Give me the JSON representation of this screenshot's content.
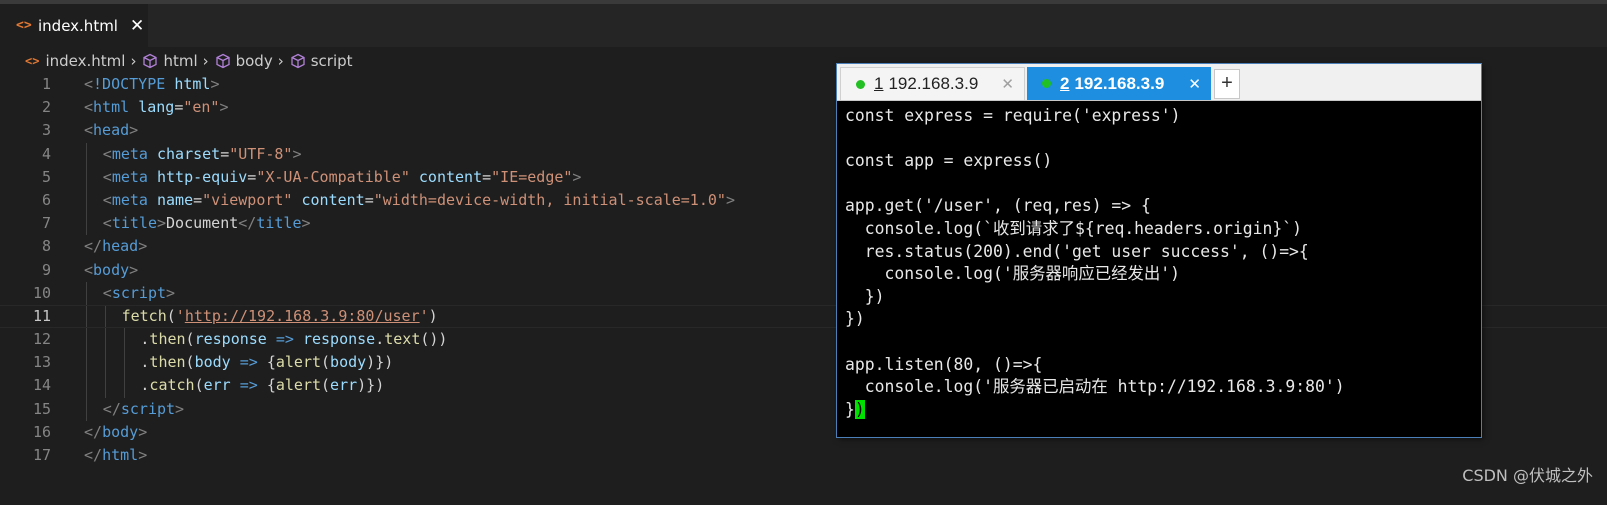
{
  "editor": {
    "tab": {
      "icon": "html-file-icon",
      "label": "index.html",
      "close": "✕"
    },
    "breadcrumb": [
      "index.html",
      "html",
      "body",
      "script"
    ],
    "current_line": 11,
    "lines": [
      {
        "n": "1",
        "indent": 0,
        "tokens": [
          [
            "br",
            "<"
          ],
          [
            "doct",
            "!DOCTYPE"
          ],
          [
            "txt",
            " "
          ],
          [
            "attr",
            "html"
          ],
          [
            "br",
            ">"
          ]
        ]
      },
      {
        "n": "2",
        "indent": 0,
        "tokens": [
          [
            "br",
            "<"
          ],
          [
            "tag",
            "html"
          ],
          [
            "txt",
            " "
          ],
          [
            "attr",
            "lang"
          ],
          [
            "txt",
            "="
          ],
          [
            "val",
            "\"en\""
          ],
          [
            "br",
            ">"
          ]
        ]
      },
      {
        "n": "3",
        "indent": 0,
        "tokens": [
          [
            "br",
            "<"
          ],
          [
            "tag",
            "head"
          ],
          [
            "br",
            ">"
          ]
        ]
      },
      {
        "n": "4",
        "indent": 1,
        "tokens": [
          [
            "br",
            "<"
          ],
          [
            "tag",
            "meta"
          ],
          [
            "txt",
            " "
          ],
          [
            "attr",
            "charset"
          ],
          [
            "txt",
            "="
          ],
          [
            "val",
            "\"UTF-8\""
          ],
          [
            "br",
            ">"
          ]
        ]
      },
      {
        "n": "5",
        "indent": 1,
        "tokens": [
          [
            "br",
            "<"
          ],
          [
            "tag",
            "meta"
          ],
          [
            "txt",
            " "
          ],
          [
            "attr",
            "http-equiv"
          ],
          [
            "txt",
            "="
          ],
          [
            "val",
            "\"X-UA-Compatible\""
          ],
          [
            "txt",
            " "
          ],
          [
            "attr",
            "content"
          ],
          [
            "txt",
            "="
          ],
          [
            "val",
            "\"IE=edge\""
          ],
          [
            "br",
            ">"
          ]
        ]
      },
      {
        "n": "6",
        "indent": 1,
        "tokens": [
          [
            "br",
            "<"
          ],
          [
            "tag",
            "meta"
          ],
          [
            "txt",
            " "
          ],
          [
            "attr",
            "name"
          ],
          [
            "txt",
            "="
          ],
          [
            "val",
            "\"viewport\""
          ],
          [
            "txt",
            " "
          ],
          [
            "attr",
            "content"
          ],
          [
            "txt",
            "="
          ],
          [
            "val",
            "\"width=device-width, initial-scale=1.0\""
          ],
          [
            "br",
            ">"
          ]
        ]
      },
      {
        "n": "7",
        "indent": 1,
        "tokens": [
          [
            "br",
            "<"
          ],
          [
            "tag",
            "title"
          ],
          [
            "br",
            ">"
          ],
          [
            "txt",
            "Document"
          ],
          [
            "br",
            "</"
          ],
          [
            "tag",
            "title"
          ],
          [
            "br",
            ">"
          ]
        ]
      },
      {
        "n": "8",
        "indent": 0,
        "tokens": [
          [
            "br",
            "</"
          ],
          [
            "tag",
            "head"
          ],
          [
            "br",
            ">"
          ]
        ]
      },
      {
        "n": "9",
        "indent": 0,
        "tokens": [
          [
            "br",
            "<"
          ],
          [
            "tag",
            "body"
          ],
          [
            "br",
            ">"
          ]
        ]
      },
      {
        "n": "10",
        "indent": 1,
        "tokens": [
          [
            "br",
            "<"
          ],
          [
            "tag",
            "script"
          ],
          [
            "br",
            ">"
          ]
        ]
      },
      {
        "n": "11",
        "indent": 2,
        "tokens": [
          [
            "fn",
            "fetch"
          ],
          [
            "txt",
            "("
          ],
          [
            "val",
            "'"
          ],
          [
            "url",
            "http://192.168.3.9:80/user"
          ],
          [
            "val",
            "'"
          ],
          [
            "txt",
            ")"
          ]
        ]
      },
      {
        "n": "12",
        "indent": 3,
        "tokens": [
          [
            "txt",
            "."
          ],
          [
            "fn",
            "then"
          ],
          [
            "txt",
            "("
          ],
          [
            "par",
            "response"
          ],
          [
            "txt",
            " "
          ],
          [
            "arrow",
            "=>"
          ],
          [
            "txt",
            " "
          ],
          [
            "par",
            "response"
          ],
          [
            "txt",
            "."
          ],
          [
            "fn",
            "text"
          ],
          [
            "txt",
            "())"
          ]
        ]
      },
      {
        "n": "13",
        "indent": 3,
        "tokens": [
          [
            "txt",
            "."
          ],
          [
            "fn",
            "then"
          ],
          [
            "txt",
            "("
          ],
          [
            "par",
            "body"
          ],
          [
            "txt",
            " "
          ],
          [
            "arrow",
            "=>"
          ],
          [
            "txt",
            " {"
          ],
          [
            "fn",
            "alert"
          ],
          [
            "txt",
            "("
          ],
          [
            "par",
            "body"
          ],
          [
            "txt",
            ")})"
          ]
        ]
      },
      {
        "n": "14",
        "indent": 3,
        "tokens": [
          [
            "txt",
            "."
          ],
          [
            "fn",
            "catch"
          ],
          [
            "txt",
            "("
          ],
          [
            "par",
            "err"
          ],
          [
            "txt",
            " "
          ],
          [
            "arrow",
            "=>"
          ],
          [
            "txt",
            " {"
          ],
          [
            "fn",
            "alert"
          ],
          [
            "txt",
            "("
          ],
          [
            "par",
            "err"
          ],
          [
            "txt",
            ")})"
          ]
        ]
      },
      {
        "n": "15",
        "indent": 1,
        "tokens": [
          [
            "br",
            "</"
          ],
          [
            "tag",
            "script"
          ],
          [
            "br",
            ">"
          ]
        ]
      },
      {
        "n": "16",
        "indent": 0,
        "tokens": [
          [
            "br",
            "</"
          ],
          [
            "tag",
            "body"
          ],
          [
            "br",
            ">"
          ]
        ]
      },
      {
        "n": "17",
        "indent": 0,
        "tokens": [
          [
            "br",
            "</"
          ],
          [
            "tag",
            "html"
          ],
          [
            "br",
            ">"
          ]
        ]
      }
    ]
  },
  "terminal": {
    "tabs": [
      {
        "num": "1",
        "label": "192.168.3.9",
        "active": false,
        "close": "✕"
      },
      {
        "num": "2",
        "label": "192.168.3.9",
        "active": true,
        "close": "✕"
      }
    ],
    "add_label": "+",
    "lines": [
      "const express = require('express')",
      "",
      "const app = express()",
      "",
      "app.get('/user', (req,res) => {",
      "  console.log(`收到请求了${req.headers.origin}`)",
      "  res.status(200).end('get user success', ()=>{",
      "    console.log('服务器响应已经发出')",
      "  })",
      "})",
      "",
      "app.listen(80, ()=>{",
      "  console.log('服务器已启动在 http://192.168.3.9:80')",
      "}"
    ],
    "cursor_char": ")"
  },
  "colors": {
    "tag": "#569cd6",
    "attr": "#9cdcfe",
    "value": "#ce9178",
    "function": "#dcdcaa",
    "terminal_tab_active": "#1e8fe0",
    "terminal_dot": "#22c022",
    "cursor": "#00e000"
  },
  "watermark": "CSDN @伏城之外"
}
